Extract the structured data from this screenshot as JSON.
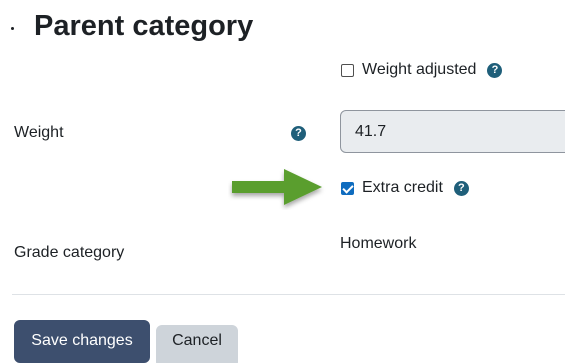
{
  "header": {
    "title": "Parent category"
  },
  "form": {
    "weight_adjusted_label": "Weight adjusted",
    "weight_label": "Weight",
    "weight_value": "41.7",
    "extra_credit_label": "Extra credit",
    "extra_credit_checked": true,
    "weight_adjusted_checked": false,
    "grade_category_label": "Grade category",
    "grade_category_value": "Homework",
    "help_glyph": "?"
  },
  "actions": {
    "save_label": "Save changes",
    "cancel_label": "Cancel"
  },
  "icons": {
    "help": "question-circle-icon",
    "annotation": "green-arrow-icon"
  },
  "colors": {
    "primary_button": "#3d4f6e",
    "secondary_button": "#ced4da",
    "checkbox_checked": "#0f6cbf",
    "help_icon": "#1f5f7a",
    "arrow": "#5a9e2f",
    "input_background": "#e9ecef"
  }
}
